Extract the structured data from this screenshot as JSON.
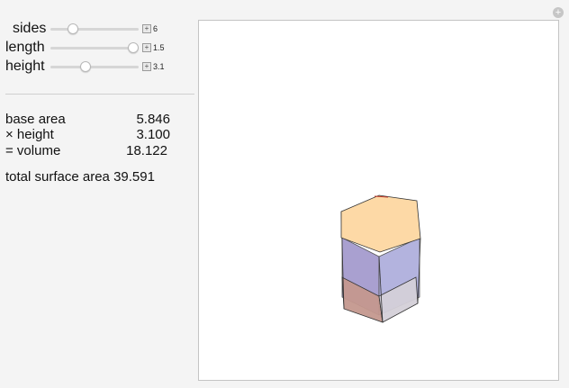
{
  "controls": {
    "sides": {
      "label": "sides",
      "value": "6",
      "level": 0.25
    },
    "length": {
      "label": "length",
      "value": "1.5",
      "level": 0.94
    },
    "height": {
      "label": "height",
      "value": "3.1",
      "level": 0.4
    },
    "plus_glyph": "+"
  },
  "results": {
    "base_area_label": "base area",
    "base_area_value": "5.846",
    "times_height_label": "× height",
    "times_height_value": "3.100",
    "volume_label": "= volume",
    "volume_value": "18.122",
    "surface_area_text": "total surface area 39.591"
  },
  "toolbar": {
    "reset_glyph": "+"
  },
  "colors": {
    "top_face": "#fdd9a6",
    "front_left_face": "#c4988e",
    "front_right_face": "#d4d0d8",
    "back_left_face": "#9a8fc8",
    "back_right_face": "#a6a6d8",
    "edge": "#333333"
  }
}
